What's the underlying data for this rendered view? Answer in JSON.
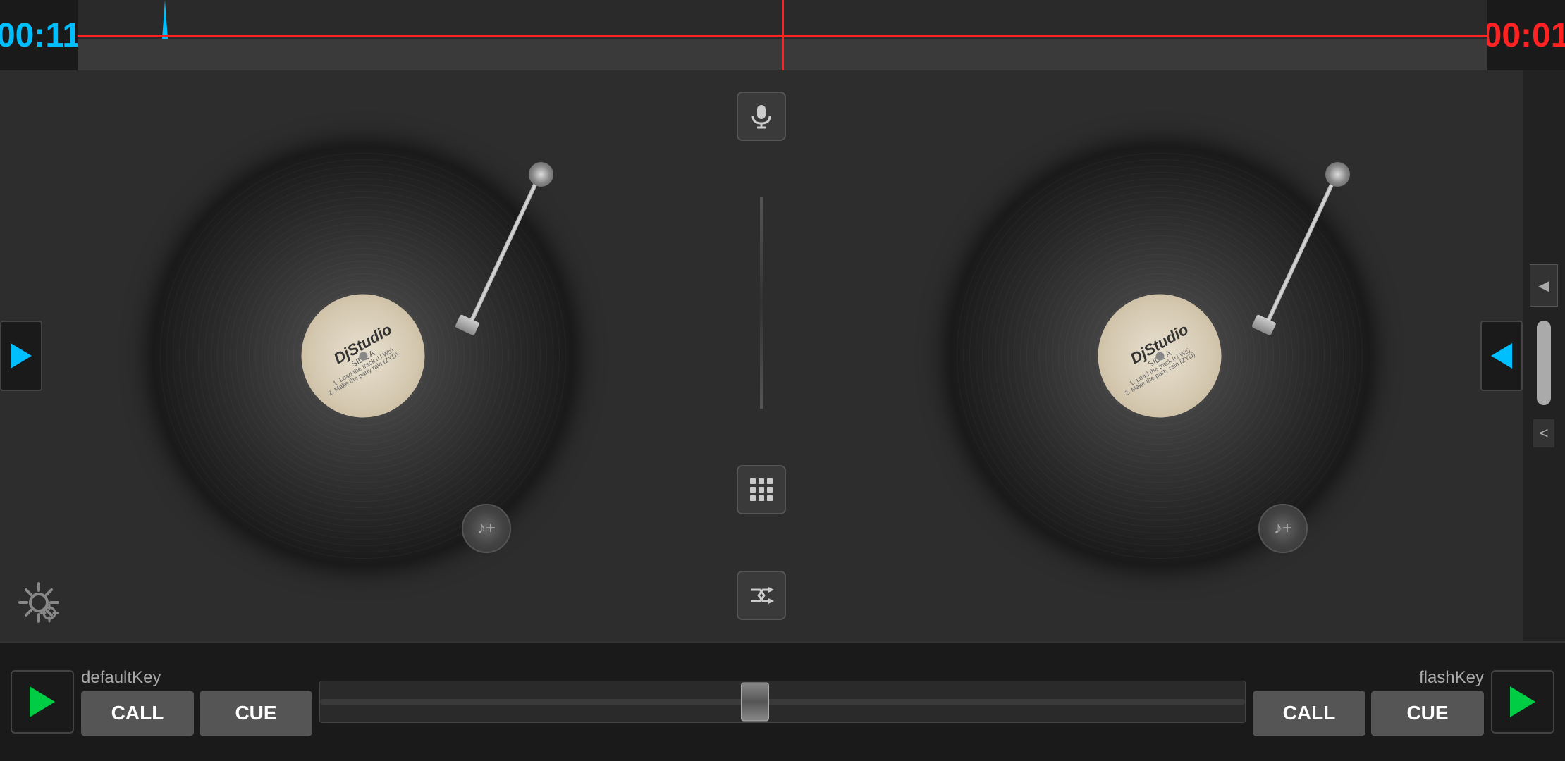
{
  "header": {
    "time_left": "00:11",
    "time_right": "00:01"
  },
  "center": {
    "mic_label": "mic",
    "grid_label": "grid",
    "shuffle_label": "shuffle"
  },
  "left_deck": {
    "label": "defaultKey",
    "play_label": "▶",
    "cue_label": "CUE",
    "call_label": "CALL",
    "add_track_icon": "music-add",
    "vinyl_brand": "DjStudio",
    "vinyl_side": "SIDE A",
    "vinyl_line1": "1. Load the track (U Ws)",
    "vinyl_line2": "2. Make the party rain (ZYD)"
  },
  "right_deck": {
    "label": "flashKey",
    "play_label": "▶",
    "cue_label": "CUE",
    "call_label": "CALL",
    "add_track_icon": "music-add",
    "vinyl_brand": "DjStudio",
    "vinyl_side": "SIDE A",
    "vinyl_line1": "1. Load the track (U Ws)",
    "vinyl_line2": "2. Make the party rain (ZYD)"
  },
  "crossfader": {
    "position": 47
  },
  "settings": {
    "icon": "gear"
  },
  "right_edge": {
    "collapse_label": "<"
  }
}
